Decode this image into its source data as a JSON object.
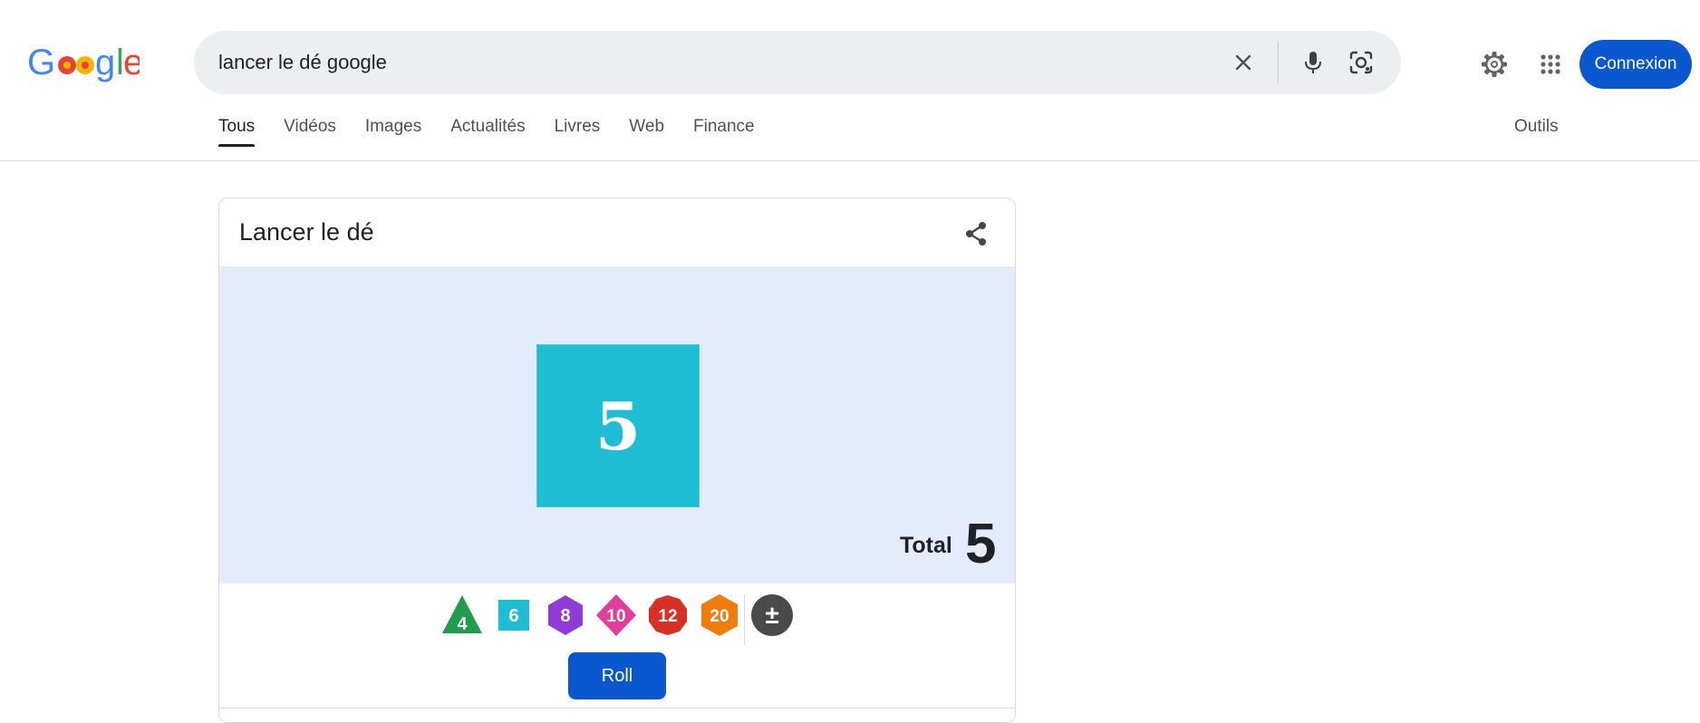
{
  "search": {
    "query": "lancer le dé google"
  },
  "header": {
    "signin_label": "Connexion"
  },
  "tabs": [
    {
      "label": "Tous",
      "active": true
    },
    {
      "label": "Vidéos"
    },
    {
      "label": "Images"
    },
    {
      "label": "Actualités"
    },
    {
      "label": "Livres"
    },
    {
      "label": "Web"
    },
    {
      "label": "Finance"
    }
  ],
  "tools_label": "Outils",
  "dice_card": {
    "title": "Lancer le dé",
    "die_result": "5",
    "total_label": "Total",
    "total_value": "5",
    "roll_label": "Roll",
    "dice_types": [
      {
        "label": "4",
        "color": "#1e9e4a"
      },
      {
        "label": "6",
        "color": "#1fbdd4"
      },
      {
        "label": "8",
        "color": "#8e3bd8"
      },
      {
        "label": "10",
        "color": "#e03d9c"
      },
      {
        "label": "12",
        "color": "#d93025"
      },
      {
        "label": "20",
        "color": "#f07c0a"
      }
    ],
    "modifier_label": "±"
  },
  "colors": {
    "accent": "#0b57d0",
    "roll_area_bg": "#e4ebfb",
    "die_face": "#1fbdd4"
  }
}
